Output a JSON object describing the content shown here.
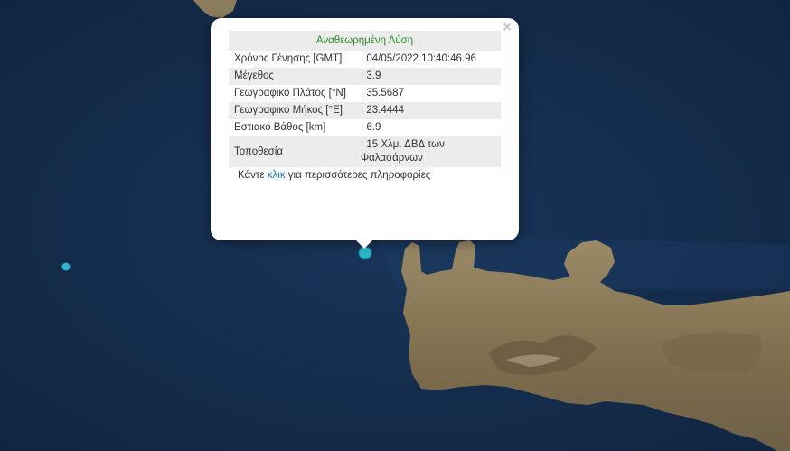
{
  "popup": {
    "title": "Αναθεωρημένη Λύση",
    "close_icon": "×",
    "rows": [
      {
        "label": "Χρόνος Γένησης [GMT]",
        "value": ": 04/05/2022 10:40:46.96"
      },
      {
        "label": "Μέγεθος",
        "value": ": 3.9"
      },
      {
        "label": "Γεωγραφικό Πλάτος [°N]",
        "value": ": 35.5687"
      },
      {
        "label": "Γεωγραφικό Μήκος [°E]",
        "value": ": 23.4444"
      },
      {
        "label": "Εστιακό Βάθος [km]",
        "value": ": 6.9"
      },
      {
        "label": "Τοποθεσία",
        "value": ": 15 Χλμ. ΔΒΔ των Φαλασάρνων"
      }
    ],
    "more_prefix": "Κάντε ",
    "more_link": "κλικ",
    "more_suffix": " για περισσότερες πληροφορίες"
  },
  "colors": {
    "sea": "#122a47",
    "land": "#8a7a58",
    "marker": "#2bb7c9",
    "title_green": "#2a8c2a",
    "link": "#1a73b5"
  }
}
